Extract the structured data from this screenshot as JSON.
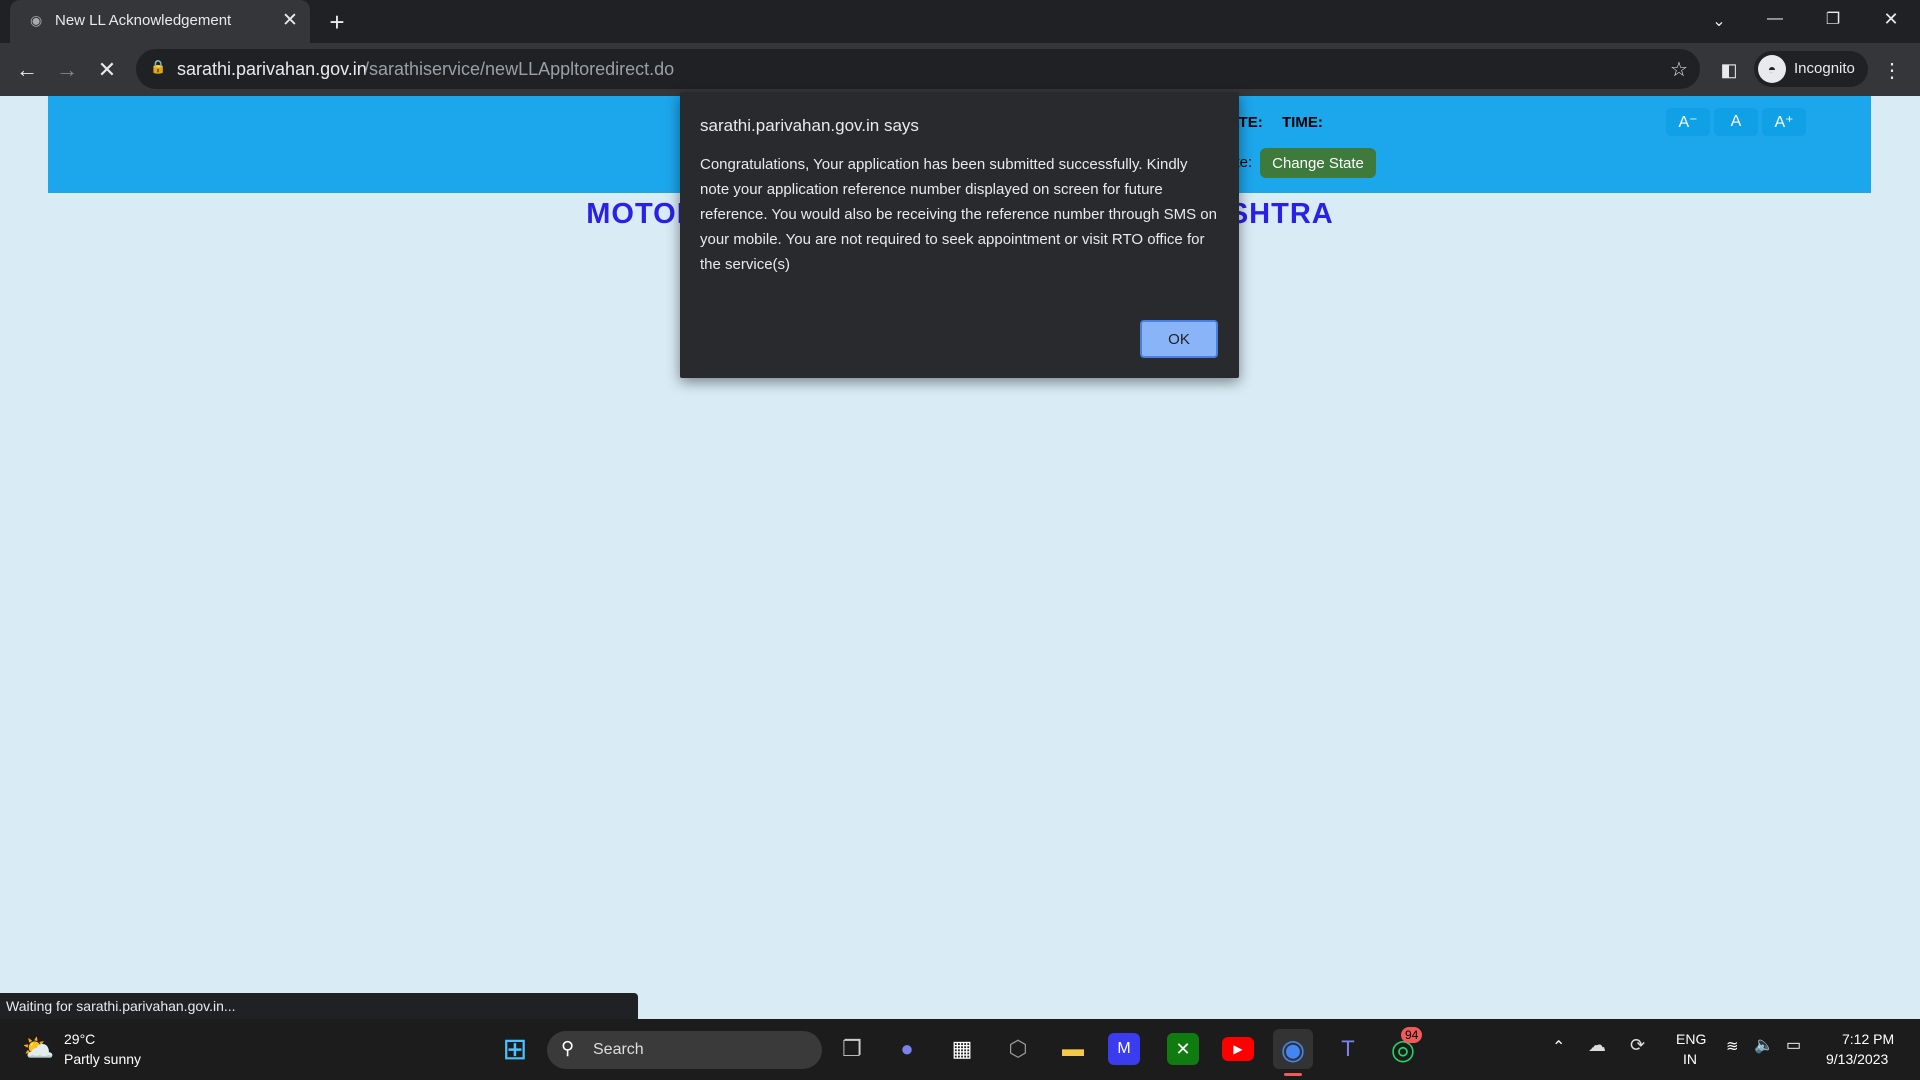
{
  "browser": {
    "tab_title": "New LL Acknowledgement",
    "url_host": "sarathi.parivahan.gov.in",
    "url_path": "/sarathiservice/newLLAppltoredirect.do",
    "profile": "Incognito"
  },
  "page": {
    "date_label": "DATE:",
    "time_label": "TIME:",
    "state_label": "State:",
    "change_state": "Change State",
    "font_small": "A⁻",
    "font_normal": "A",
    "font_large": "A⁺",
    "heading": "MOTOR VEHICLES DEPARTMENT, MAHARASHTRA"
  },
  "dialog": {
    "title": "sarathi.parivahan.gov.in says",
    "message": "Congratulations, Your application has been submitted successfully. Kindly note your application reference number displayed on screen for future reference. You would also be receiving the reference number through SMS on your mobile. You are not required to seek appointment or visit RTO office for the service(s)",
    "ok": "OK"
  },
  "status_bar": "Waiting for sarathi.parivahan.gov.in...",
  "taskbar": {
    "weather_temp": "29°C",
    "weather_desc": "Partly sunny",
    "search": "Search",
    "whatsapp_badge": "94",
    "lang": "ENG",
    "region": "IN",
    "time": "7:12 PM",
    "date": "9/13/2023"
  },
  "colors": {
    "header": "#1ca6ec",
    "heading": "#2c1fe8",
    "change_state": "#3d7a3b",
    "page_bg": "#d9ecf6"
  }
}
